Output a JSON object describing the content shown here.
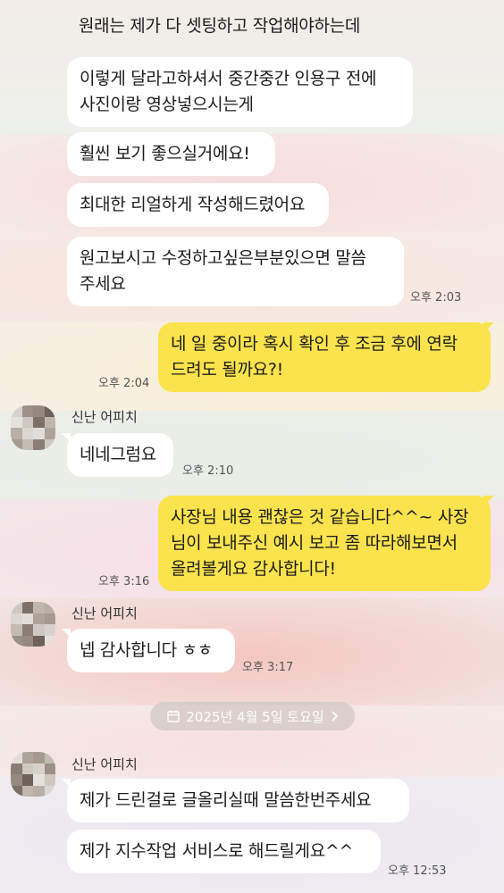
{
  "chat": {
    "messages_top": [
      "원래는 제가 다 셋팅하고 작업해야하는데",
      "이렇게 달라고하셔서 중간중간 인용구 전에\n사진이랑 영상넣으시는게",
      "훨씬 보기 좋으실거에요!",
      "최대한 리얼하게 작성해드렸어요",
      "원고보시고 수정하고싶은부분있으면 말씀\n주세요"
    ],
    "time_1": "오후 2:03",
    "my_msg_1": "네 일 중이라 혹시 확인 후 조금 후에 연락\n드려도 될까요?!",
    "time_2": "오후 2:04",
    "sender_name": "신난 어피치",
    "reply_1": "네네그럼요",
    "time_3": "오후 2:10",
    "my_msg_2": "사장님 내용 괜찮은 것 같습니다^^~ 사장\n님이 보내주신 예시 보고 좀 따라해보면서\n올려볼게요 감사합니다!",
    "time_4": "오후 3:16",
    "reply_2": "넵 감사합니다 ㅎㅎ",
    "time_5": "오후 3:17",
    "date_divider": "2025년 4월 5일 토요일",
    "reply_3": "제가 드린걸로 글올리실때 말씀한번주세요",
    "reply_4": "제가 지수작업 서비스로 해드릴게요^^",
    "time_6": "오후 12:53"
  },
  "colors": {
    "my_bubble": "#fae34d",
    "their_bubble": "#ffffff"
  },
  "icons": [
    "calendar-icon",
    "chevron-right-icon",
    "pixelated-avatar"
  ]
}
